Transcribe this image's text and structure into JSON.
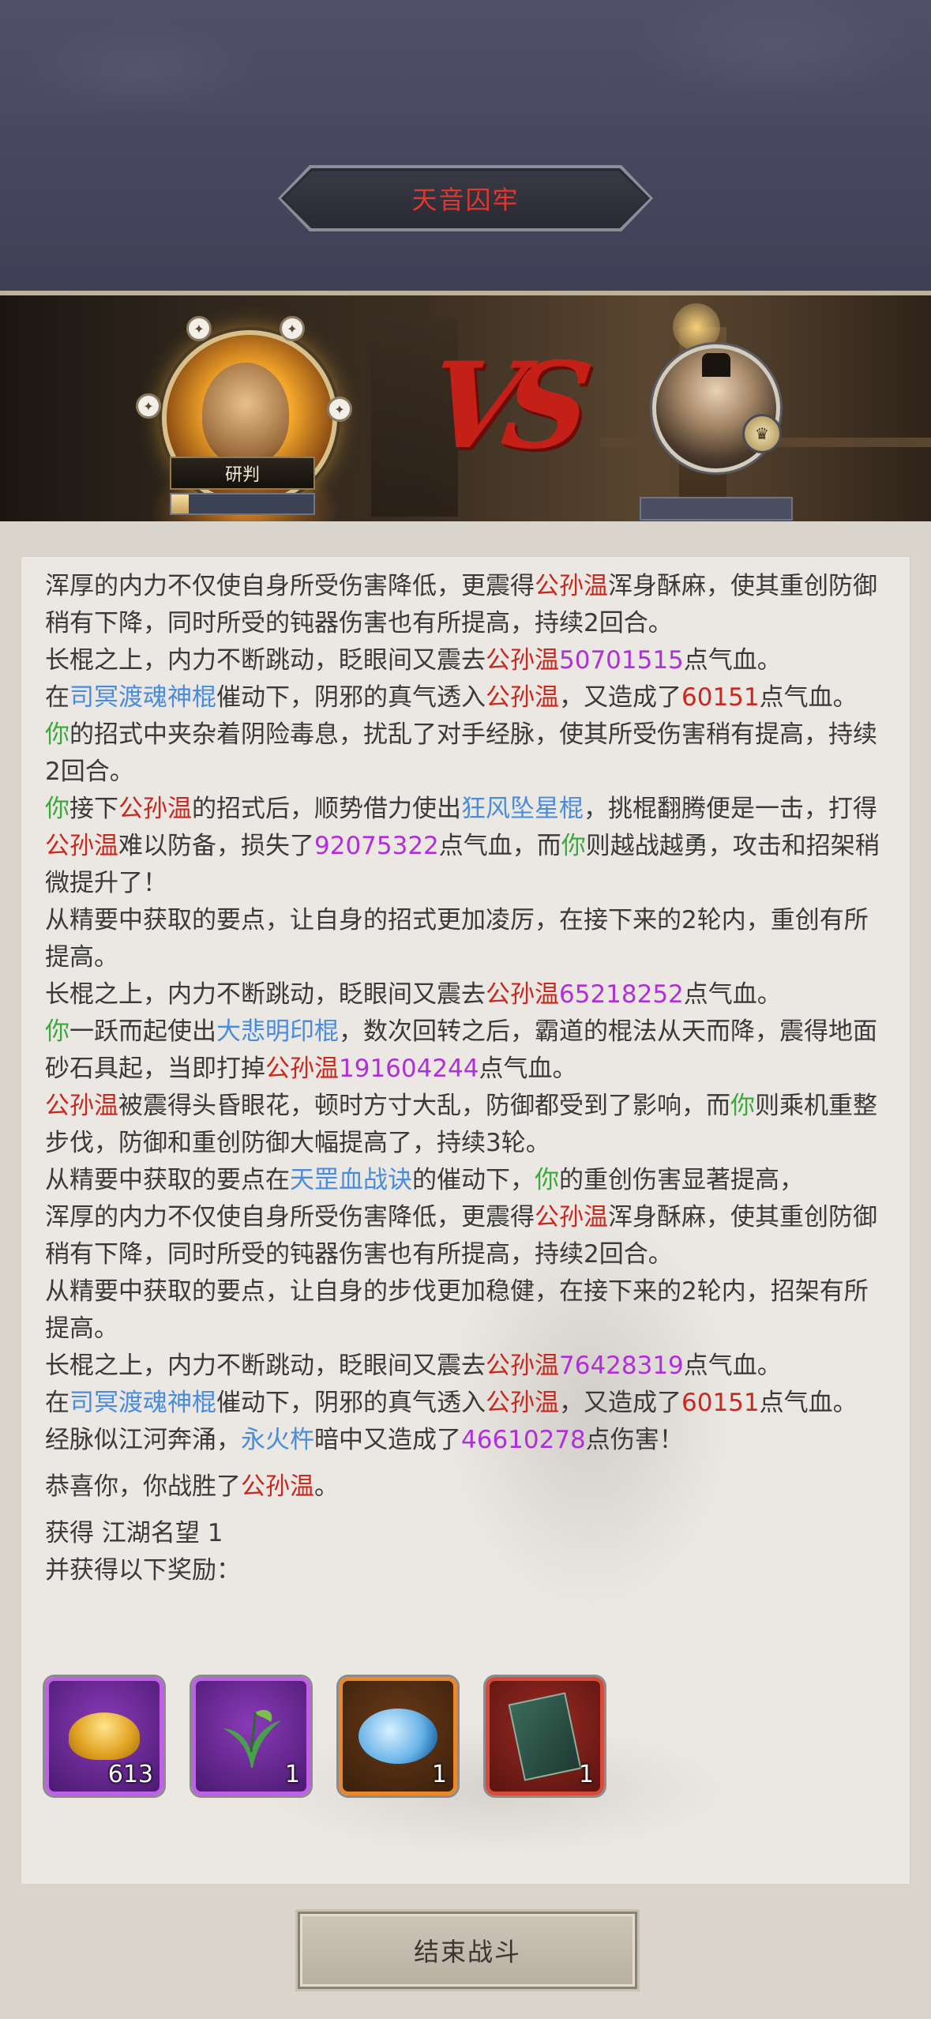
{
  "header": {
    "title": "天音囚牢"
  },
  "battle": {
    "player": {
      "name": "研判",
      "hp_fraction": 0.12
    },
    "vs_text": "VS",
    "enemy": {
      "hp_fraction": 0
    }
  },
  "log": [
    {
      "segments": [
        {
          "t": "浑厚的内力不仅使自身所受伤害降低，更震得"
        },
        {
          "t": "公孙温",
          "c": "red"
        },
        {
          "t": "浑身酥麻，使其重创防御稍有下降，同时所受的钝器伤害也有所提高，持续2回合。"
        }
      ]
    },
    {
      "segments": [
        {
          "t": "长棍之上，内力不断跳动，眨眼间又震去"
        },
        {
          "t": "公孙温",
          "c": "red"
        },
        {
          "t": "50701515",
          "c": "purple"
        },
        {
          "t": "点气血。"
        }
      ]
    },
    {
      "segments": [
        {
          "t": "在"
        },
        {
          "t": "司冥渡魂神棍",
          "c": "blue"
        },
        {
          "t": "催动下，阴邪的真气透入"
        },
        {
          "t": "公孙温",
          "c": "red"
        },
        {
          "t": "，又造成了"
        },
        {
          "t": "60151",
          "c": "red"
        },
        {
          "t": "点气血。"
        }
      ]
    },
    {
      "segments": [
        {
          "t": "你",
          "c": "green"
        },
        {
          "t": "的招式中夹杂着阴险毒息，扰乱了对手经脉，使其所受伤害稍有提高，持续2回合。"
        }
      ]
    },
    {
      "segments": [
        {
          "t": "你",
          "c": "green"
        },
        {
          "t": "接下"
        },
        {
          "t": "公孙温",
          "c": "red"
        },
        {
          "t": "的招式后，顺势借力使出"
        },
        {
          "t": "狂风坠星棍",
          "c": "blue"
        },
        {
          "t": "，挑棍翻腾便是一击，打得"
        },
        {
          "t": "公孙温",
          "c": "red"
        },
        {
          "t": "难以防备，损失了"
        },
        {
          "t": "92075322",
          "c": "purple"
        },
        {
          "t": "点气血，而"
        },
        {
          "t": "你",
          "c": "green"
        },
        {
          "t": "则越战越勇，攻击和招架稍微提升了！"
        }
      ]
    },
    {
      "segments": [
        {
          "t": "从精要中获取的要点，让自身的招式更加凌厉，在接下来的2轮内，重创有所提高。"
        }
      ]
    },
    {
      "segments": [
        {
          "t": "长棍之上，内力不断跳动，眨眼间又震去"
        },
        {
          "t": "公孙温",
          "c": "red"
        },
        {
          "t": "65218252",
          "c": "purple"
        },
        {
          "t": "点气血。"
        }
      ]
    },
    {
      "segments": [
        {
          "t": "你",
          "c": "green"
        },
        {
          "t": "一跃而起使出"
        },
        {
          "t": "大悲明印棍",
          "c": "blue"
        },
        {
          "t": "，数次回转之后，霸道的棍法从天而降，震得地面砂石具起，当即打掉"
        },
        {
          "t": "公孙温",
          "c": "red"
        },
        {
          "t": "191604244",
          "c": "purple"
        },
        {
          "t": "点气血。"
        }
      ]
    },
    {
      "segments": [
        {
          "t": "公孙温",
          "c": "red"
        },
        {
          "t": "被震得头昏眼花，顿时方寸大乱，防御都受到了影响，而"
        },
        {
          "t": "你",
          "c": "green"
        },
        {
          "t": "则乘机重整步伐，防御和重创防御大幅提高了，持续3轮。"
        }
      ]
    },
    {
      "segments": [
        {
          "t": "从精要中获取的要点在"
        },
        {
          "t": "天罡血战诀",
          "c": "blue"
        },
        {
          "t": "的催动下，"
        },
        {
          "t": "你",
          "c": "green"
        },
        {
          "t": "的重创伤害显著提高，"
        }
      ]
    },
    {
      "segments": [
        {
          "t": "浑厚的内力不仅使自身所受伤害降低，更震得"
        },
        {
          "t": "公孙温",
          "c": "red"
        },
        {
          "t": "浑身酥麻，使其重创防御稍有下降，同时所受的钝器伤害也有所提高，持续2回合。"
        }
      ]
    },
    {
      "segments": [
        {
          "t": "从精要中获取的要点，让自身的步伐更加稳健，在接下来的2轮内，招架有所提高。"
        }
      ]
    },
    {
      "segments": [
        {
          "t": "长棍之上，内力不断跳动，眨眼间又震去"
        },
        {
          "t": "公孙温",
          "c": "red"
        },
        {
          "t": "76428319",
          "c": "purple"
        },
        {
          "t": "点气血。"
        }
      ]
    },
    {
      "segments": [
        {
          "t": "在"
        },
        {
          "t": "司冥渡魂神棍",
          "c": "blue"
        },
        {
          "t": "催动下，阴邪的真气透入"
        },
        {
          "t": "公孙温",
          "c": "red"
        },
        {
          "t": "，又造成了"
        },
        {
          "t": "60151",
          "c": "red"
        },
        {
          "t": "点气血。"
        }
      ]
    },
    {
      "segments": [
        {
          "t": "经脉似江河奔涌，"
        },
        {
          "t": "永火杵",
          "c": "blue"
        },
        {
          "t": "暗中又造成了"
        },
        {
          "t": "46610278",
          "c": "purple"
        },
        {
          "t": "点伤害！"
        }
      ]
    }
  ],
  "result": {
    "victory": [
      {
        "t": "恭喜你，你战胜了"
      },
      {
        "t": "公孙温",
        "c": "red"
      },
      {
        "t": "。"
      }
    ],
    "fame_label": "获得 江湖名望 1",
    "rewards_label": "并获得以下奖励："
  },
  "rewards": [
    {
      "icon": "gold-ingot-icon",
      "count": "613",
      "rarity": "purple"
    },
    {
      "icon": "herb-icon",
      "count": "1",
      "rarity": "purple"
    },
    {
      "icon": "cloud-swirl-icon",
      "count": "1",
      "rarity": "orange"
    },
    {
      "icon": "skill-book-icon",
      "count": "1",
      "rarity": "red"
    }
  ],
  "footer": {
    "end_button": "结束战斗"
  },
  "colors": {
    "red": "#c8281e",
    "blue": "#4a8cdc",
    "green": "#3aa83a",
    "purple": "#b030d8"
  }
}
